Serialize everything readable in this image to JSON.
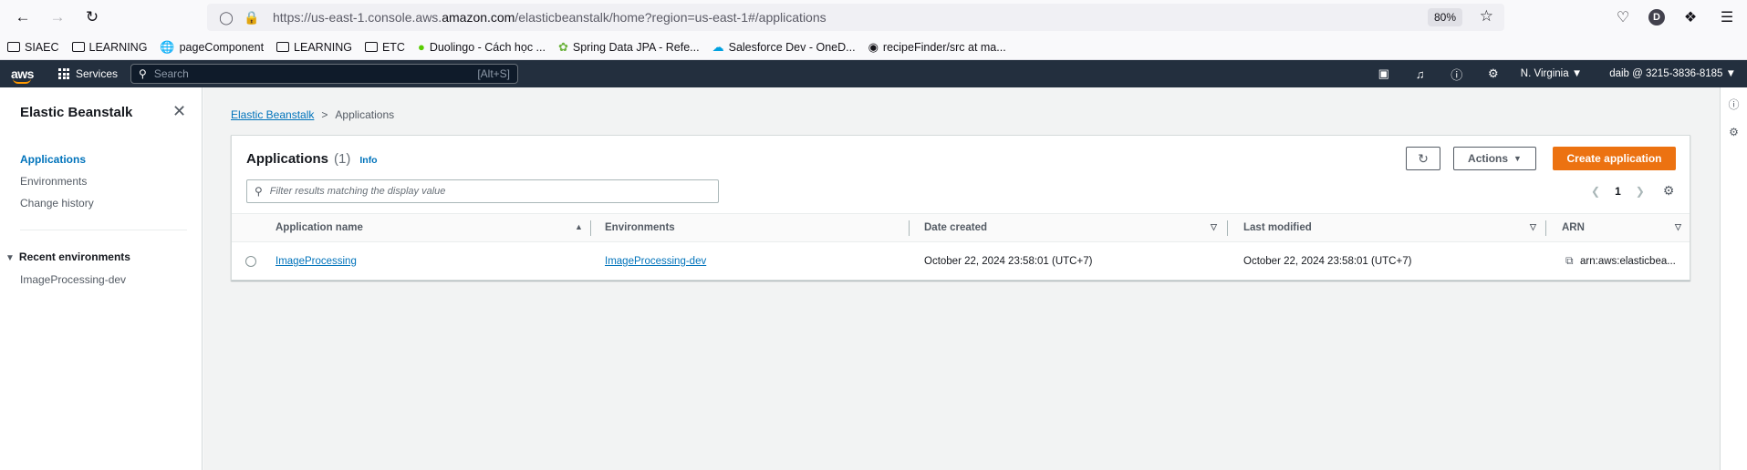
{
  "browser": {
    "url_prefix": "https://us-east-1.console.aws.",
    "url_domain": "amazon.com",
    "url_suffix": "/elasticbeanstalk/home?region=us-east-1#/applications",
    "zoom": "80%",
    "profile_initial": "D"
  },
  "bookmarks": [
    {
      "label": "SIAEC",
      "icon": "folder-icon"
    },
    {
      "label": "LEARNING",
      "icon": "folder-icon"
    },
    {
      "label": "pageComponent",
      "icon": "globe-icon"
    },
    {
      "label": "LEARNING",
      "icon": "folder-icon"
    },
    {
      "label": "ETC",
      "icon": "folder-icon"
    },
    {
      "label": "Duolingo - Cách học ...",
      "icon": "duolingo-icon"
    },
    {
      "label": "Spring Data JPA - Refe...",
      "icon": "spring-icon"
    },
    {
      "label": "Salesforce Dev - OneD...",
      "icon": "cloud-icon"
    },
    {
      "label": "recipeFinder/src at ma...",
      "icon": "github-icon"
    }
  ],
  "aws_nav": {
    "services": "Services",
    "search_placeholder": "Search",
    "search_shortcut": "[Alt+S]",
    "region": "N. Virginia ▼",
    "account": "daib @ 3215-3836-8185 ▼"
  },
  "sidebar": {
    "title": "Elastic Beanstalk",
    "items": [
      {
        "label": "Applications",
        "active": true
      },
      {
        "label": "Environments",
        "active": false
      },
      {
        "label": "Change history",
        "active": false
      }
    ],
    "section_title": "Recent environments",
    "recent": [
      {
        "label": "ImageProcessing-dev"
      }
    ]
  },
  "breadcrumb": {
    "root": "Elastic Beanstalk",
    "separator": ">",
    "current": "Applications"
  },
  "panel": {
    "title": "Applications",
    "count": "(1)",
    "info": "Info",
    "actions_label": "Actions",
    "create_label": "Create application",
    "filter_placeholder": "Filter results matching the display value",
    "page": "1"
  },
  "table": {
    "columns": [
      "Application name",
      "Environments",
      "Date created",
      "Last modified",
      "ARN"
    ],
    "rows": [
      {
        "name": "ImageProcessing",
        "environments": "ImageProcessing-dev",
        "date_created": "October 22, 2024 23:58:01 (UTC+7)",
        "last_modified": "October 22, 2024 23:58:01 (UTC+7)",
        "arn": "arn:aws:elasticbea..."
      }
    ]
  },
  "colors": {
    "aws_nav_bg": "#232f3e",
    "primary_button": "#ec7211",
    "link": "#0073bb"
  }
}
